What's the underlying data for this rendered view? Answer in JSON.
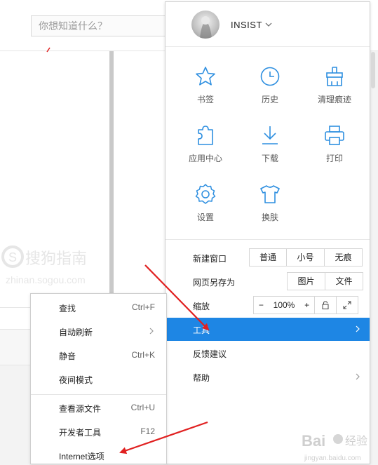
{
  "search": {
    "placeholder": "你想知道什么？"
  },
  "user": {
    "name": "INSIST"
  },
  "grid_items": [
    {
      "label": "书签",
      "icon": "star-icon"
    },
    {
      "label": "历史",
      "icon": "clock-icon"
    },
    {
      "label": "清理痕迹",
      "icon": "broom-icon"
    },
    {
      "label": "应用中心",
      "icon": "puzzle-icon"
    },
    {
      "label": "下载",
      "icon": "download-icon"
    },
    {
      "label": "打印",
      "icon": "printer-icon"
    },
    {
      "label": "设置",
      "icon": "gear-icon"
    },
    {
      "label": "换肤",
      "icon": "tshirt-icon"
    }
  ],
  "menu": {
    "new_window": {
      "label": "新建窗口",
      "options": [
        "普通",
        "小号",
        "无痕"
      ]
    },
    "save_as": {
      "label": "网页另存为",
      "options": [
        "图片",
        "文件"
      ]
    },
    "zoom": {
      "label": "缩放",
      "minus": "−",
      "value": "100%",
      "plus": "+"
    },
    "tools": "工具",
    "feedback": "反馈建议",
    "help": "帮助"
  },
  "submenu": {
    "find": {
      "label": "查找",
      "shortcut": "Ctrl+F"
    },
    "auto_refresh": {
      "label": "自动刷新"
    },
    "mute": {
      "label": "静音",
      "shortcut": "Ctrl+K"
    },
    "night_mode": {
      "label": "夜间模式"
    },
    "view_source": {
      "label": "查看源文件",
      "shortcut": "Ctrl+U"
    },
    "dev_tools": {
      "label": "开发者工具",
      "shortcut": "F12"
    },
    "internet_options": {
      "label": "Internet选项"
    }
  },
  "colors": {
    "accent": "#1e86e4",
    "icon": "#2e8fe0",
    "arrow": "#e02020"
  },
  "watermarks": {
    "sogou_cn": "搜狗指南",
    "sogou_url": "zhinan.sogou.com",
    "baidu": "Bai",
    "baidu_cn": "经验",
    "baidu_url": "jingyan.baidu.com"
  }
}
